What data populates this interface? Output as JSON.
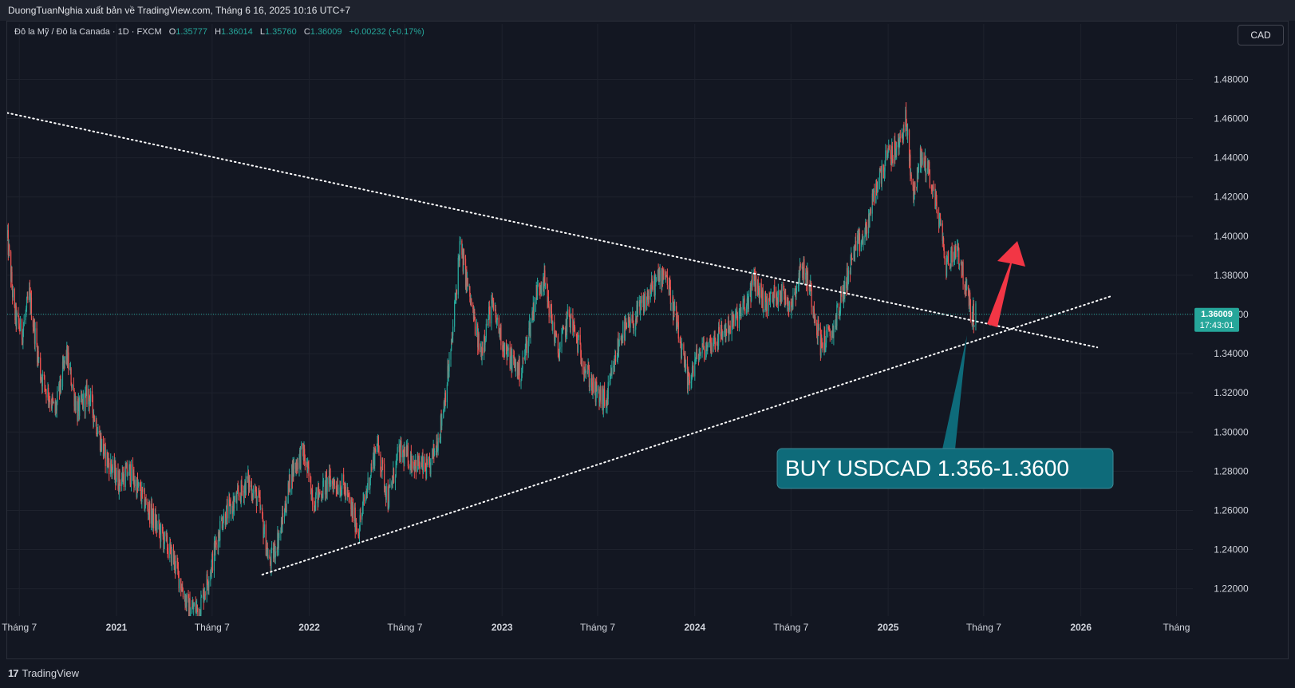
{
  "header": {
    "publish_line": "DuongTuanNghia xuất bản về TradingView.com, Tháng 6 16, 2025 10:16 UTC+7"
  },
  "legend": {
    "symbol": "Đô la Mỹ / Đô la Canada · 1D · FXCM",
    "o_label": "O",
    "o_value": "1.35777",
    "h_label": "H",
    "h_value": "1.36014",
    "l_label": "L",
    "l_value": "1.35760",
    "c_label": "C",
    "c_value": "1.36009",
    "change": "+0.00232 (+0.17%)"
  },
  "currency_button": "CAD",
  "footer": {
    "brand": "TradingView",
    "brand_icon": "tradingview-logo-icon"
  },
  "colors": {
    "background": "#131722",
    "up": "#26a69a",
    "down": "#ef5350",
    "annotation_box": "#0e6b7a",
    "arrow": "#f23645",
    "price_label_bg": "#26a69a"
  },
  "price_label": {
    "price": "1.36009",
    "countdown": "17:43:01"
  },
  "annotation": {
    "text": "BUY USDCAD 1.356-1.3600"
  },
  "chart_data": {
    "type": "candlestick",
    "title": "",
    "y_axis": {
      "range": [
        1.206,
        1.492
      ],
      "ticks": [
        "1.48000",
        "1.46000",
        "1.44000",
        "1.42000",
        "1.40000",
        "1.38000",
        "1.36000",
        "1.34000",
        "1.32000",
        "1.30000",
        "1.28000",
        "1.26000",
        "1.24000",
        "1.22000"
      ]
    },
    "x_axis": {
      "range": [
        "2020-06-08",
        "2026-08-01"
      ],
      "ticks": [
        {
          "label": "Tháng 7",
          "date": "2020-07-01",
          "year": false
        },
        {
          "label": "2021",
          "date": "2021-01-01",
          "year": true
        },
        {
          "label": "Tháng 7",
          "date": "2021-07-01",
          "year": false
        },
        {
          "label": "2022",
          "date": "2022-01-01",
          "year": true
        },
        {
          "label": "Tháng 7",
          "date": "2022-07-01",
          "year": false
        },
        {
          "label": "2023",
          "date": "2023-01-01",
          "year": true
        },
        {
          "label": "Tháng 7",
          "date": "2023-07-01",
          "year": false
        },
        {
          "label": "2024",
          "date": "2024-01-01",
          "year": true
        },
        {
          "label": "Tháng 7",
          "date": "2024-07-01",
          "year": false
        },
        {
          "label": "2025",
          "date": "2025-01-01",
          "year": true
        },
        {
          "label": "Tháng 7",
          "date": "2025-07-01",
          "year": false
        },
        {
          "label": "2026",
          "date": "2026-01-01",
          "year": true
        },
        {
          "label": "Tháng",
          "date": "2026-07-01",
          "year": false
        }
      ]
    },
    "grid": true,
    "price_path": [
      [
        "2020-06-08",
        1.4
      ],
      [
        "2020-06-22",
        1.36
      ],
      [
        "2020-07-06",
        1.35
      ],
      [
        "2020-07-20",
        1.37
      ],
      [
        "2020-08-10",
        1.33
      ],
      [
        "2020-09-07",
        1.31
      ],
      [
        "2020-09-28",
        1.34
      ],
      [
        "2020-10-19",
        1.31
      ],
      [
        "2020-11-09",
        1.32
      ],
      [
        "2020-12-07",
        1.29
      ],
      [
        "2021-01-04",
        1.275
      ],
      [
        "2021-01-25",
        1.28
      ],
      [
        "2021-02-22",
        1.265
      ],
      [
        "2021-03-22",
        1.25
      ],
      [
        "2021-04-19",
        1.235
      ],
      [
        "2021-05-17",
        1.21
      ],
      [
        "2021-06-07",
        1.21
      ],
      [
        "2021-06-28",
        1.23
      ],
      [
        "2021-07-19",
        1.255
      ],
      [
        "2021-08-16",
        1.265
      ],
      [
        "2021-09-06",
        1.275
      ],
      [
        "2021-09-27",
        1.265
      ],
      [
        "2021-10-18",
        1.232
      ],
      [
        "2021-11-08",
        1.25
      ],
      [
        "2021-11-29",
        1.28
      ],
      [
        "2021-12-20",
        1.29
      ],
      [
        "2022-01-10",
        1.265
      ],
      [
        "2022-02-07",
        1.275
      ],
      [
        "2022-03-07",
        1.272
      ],
      [
        "2022-04-04",
        1.25
      ],
      [
        "2022-05-09",
        1.295
      ],
      [
        "2022-05-30",
        1.265
      ],
      [
        "2022-06-20",
        1.29
      ],
      [
        "2022-07-18",
        1.285
      ],
      [
        "2022-08-15",
        1.28
      ],
      [
        "2022-09-05",
        1.3
      ],
      [
        "2022-09-26",
        1.34
      ],
      [
        "2022-10-13",
        1.395
      ],
      [
        "2022-10-31",
        1.37
      ],
      [
        "2022-11-21",
        1.34
      ],
      [
        "2022-12-12",
        1.365
      ],
      [
        "2023-01-09",
        1.34
      ],
      [
        "2023-02-06",
        1.33
      ],
      [
        "2023-03-06",
        1.37
      ],
      [
        "2023-03-20",
        1.38
      ],
      [
        "2023-04-17",
        1.34
      ],
      [
        "2023-05-08",
        1.36
      ],
      [
        "2023-06-05",
        1.335
      ],
      [
        "2023-06-26",
        1.32
      ],
      [
        "2023-07-17",
        1.315
      ],
      [
        "2023-08-14",
        1.35
      ],
      [
        "2023-09-04",
        1.355
      ],
      [
        "2023-09-25",
        1.365
      ],
      [
        "2023-10-16",
        1.375
      ],
      [
        "2023-11-06",
        1.383
      ],
      [
        "2023-11-27",
        1.355
      ],
      [
        "2023-12-18",
        1.325
      ],
      [
        "2024-01-08",
        1.34
      ],
      [
        "2024-01-29",
        1.345
      ],
      [
        "2024-02-19",
        1.35
      ],
      [
        "2024-03-11",
        1.355
      ],
      [
        "2024-04-08",
        1.365
      ],
      [
        "2024-04-22",
        1.378
      ],
      [
        "2024-05-13",
        1.365
      ],
      [
        "2024-06-10",
        1.372
      ],
      [
        "2024-07-01",
        1.365
      ],
      [
        "2024-07-22",
        1.385
      ],
      [
        "2024-08-05",
        1.375
      ],
      [
        "2024-08-26",
        1.345
      ],
      [
        "2024-09-16",
        1.35
      ],
      [
        "2024-10-07",
        1.37
      ],
      [
        "2024-10-28",
        1.392
      ],
      [
        "2024-11-18",
        1.4
      ],
      [
        "2024-12-09",
        1.425
      ],
      [
        "2024-12-30",
        1.44
      ],
      [
        "2025-01-20",
        1.445
      ],
      [
        "2025-02-03",
        1.46
      ],
      [
        "2025-02-17",
        1.42
      ],
      [
        "2025-03-03",
        1.44
      ],
      [
        "2025-03-17",
        1.435
      ],
      [
        "2025-04-07",
        1.41
      ],
      [
        "2025-04-21",
        1.385
      ],
      [
        "2025-05-12",
        1.395
      ],
      [
        "2025-05-26",
        1.375
      ],
      [
        "2025-06-09",
        1.36
      ],
      [
        "2025-06-16",
        1.36
      ]
    ],
    "trendlines": [
      {
        "name": "falling-resistance",
        "style": "dotted",
        "from": [
          "2020-06-08",
          1.4629
        ],
        "to": [
          "2026-02-01",
          1.3432
        ]
      },
      {
        "name": "rising-support",
        "style": "dotted",
        "from": [
          "2021-10-04",
          1.2272
        ],
        "to": [
          "2026-03-01",
          1.3695
        ]
      }
    ],
    "last_price": 1.36009,
    "last_date": "2025-06-16"
  }
}
